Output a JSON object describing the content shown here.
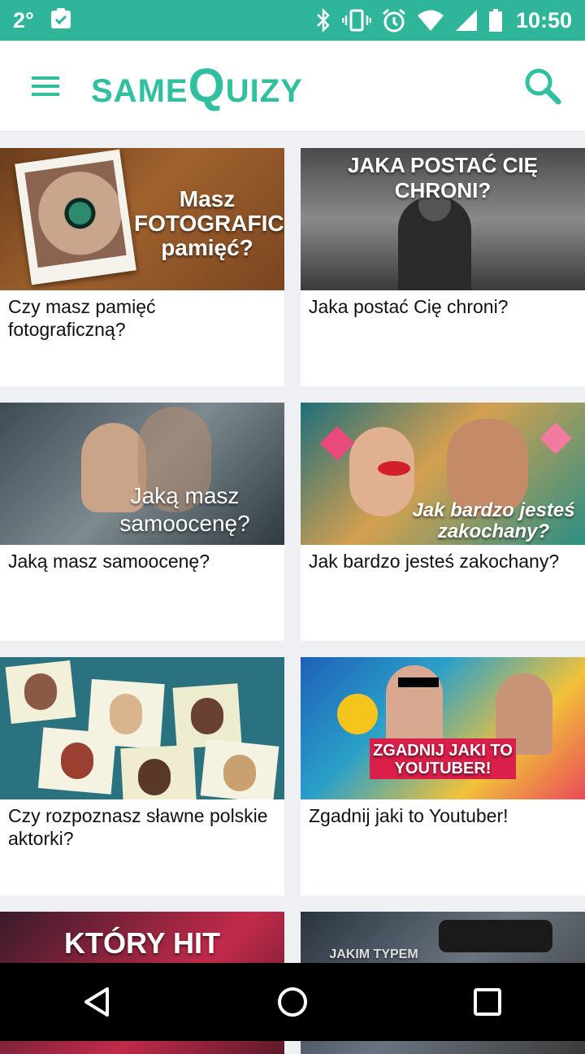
{
  "status": {
    "temperature": "2°",
    "time": "10:50",
    "icons": [
      "clipboard-check-icon",
      "bluetooth-icon",
      "vibrate-icon",
      "alarm-icon",
      "wifi-icon",
      "signal-icon",
      "battery-icon"
    ]
  },
  "header": {
    "logo_left": "SAME",
    "logo_big": "Q",
    "logo_right": "UIZY",
    "accent_color": "#30bf9f",
    "status_color": "#2fb59a"
  },
  "cards": [
    {
      "title": "Czy masz pamięć fotograficzną?",
      "thumb_text": "Masz FOTOGRAFICZNĄ pamięć?"
    },
    {
      "title": "Jaka postać Cię chroni?",
      "thumb_text": "JAKA POSTAĆ CIĘ CHRONI?"
    },
    {
      "title": "Jaką masz samoocenę?",
      "thumb_text": "Jaką masz samoocenę?"
    },
    {
      "title": "Jak bardzo jesteś zakochany?",
      "thumb_text": "Jak bardzo jesteś zakochany?"
    },
    {
      "title": "Czy rozpoznasz sławne polskie aktorki?",
      "thumb_text": ""
    },
    {
      "title": "Zgadnij jaki to Youtuber!",
      "thumb_text": "ZGADNIJ JAKI TO YOUTUBER!"
    },
    {
      "title": "",
      "thumb_text": "KTÓRY HIT"
    },
    {
      "title": "",
      "thumb_text": "JAKIM TYPEM"
    }
  ],
  "nav": {
    "icons": [
      "back-triangle-icon",
      "home-circle-icon",
      "recents-square-icon"
    ]
  }
}
